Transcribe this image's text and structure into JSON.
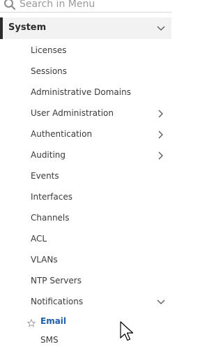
{
  "search": {
    "placeholder": "Search in Menu"
  },
  "section": {
    "label": "System"
  },
  "menu": {
    "items": [
      {
        "label": "Licenses"
      },
      {
        "label": "Sessions"
      },
      {
        "label": "Administrative Domains"
      },
      {
        "label": "User Administration"
      },
      {
        "label": "Authentication"
      },
      {
        "label": "Auditing"
      },
      {
        "label": "Events"
      },
      {
        "label": "Interfaces"
      },
      {
        "label": "Channels"
      },
      {
        "label": "ACL"
      },
      {
        "label": "VLANs"
      },
      {
        "label": "NTP Servers"
      },
      {
        "label": "Notifications"
      }
    ],
    "notifications_sub": [
      {
        "label": "Email"
      },
      {
        "label": "SMS"
      }
    ]
  },
  "colors": {
    "accent": "#1f5fa8",
    "section_bg": "#f2f2f2",
    "section_bar": "#2b2b2b"
  }
}
